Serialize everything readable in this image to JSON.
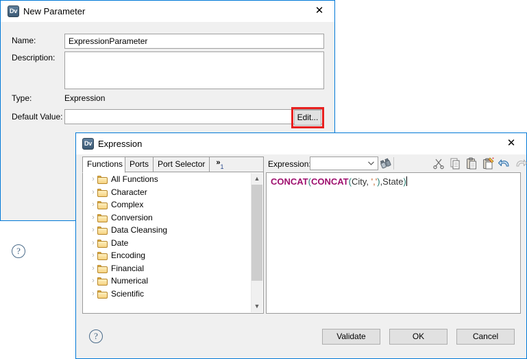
{
  "new_parameter_dialog": {
    "title": "New Parameter",
    "app_icon_label": "Dv",
    "close_label": "✕",
    "help_label": "?",
    "fields": {
      "name_label": "Name:",
      "name_value": "ExpressionParameter",
      "description_label": "Description:",
      "description_value": "",
      "type_label": "Type:",
      "type_value": "Expression",
      "default_value_label": "Default Value:",
      "default_value": "",
      "edit_button_label": "Edit..."
    }
  },
  "expression_dialog": {
    "title": "Expression",
    "app_icon_label": "Dv",
    "close_label": "✕",
    "help_label": "?",
    "tabs": [
      {
        "label": "Functions",
        "selected": true
      },
      {
        "label": "Ports",
        "selected": false
      },
      {
        "label": "Port Selector",
        "selected": false
      }
    ],
    "tab_overflow": {
      "chevrons": "»",
      "count": "1"
    },
    "tree": {
      "items": [
        {
          "label": "All Functions"
        },
        {
          "label": "Character"
        },
        {
          "label": "Complex"
        },
        {
          "label": "Conversion"
        },
        {
          "label": "Data Cleansing"
        },
        {
          "label": "Date"
        },
        {
          "label": "Encoding"
        },
        {
          "label": "Financial"
        },
        {
          "label": "Numerical"
        },
        {
          "label": "Scientific"
        }
      ],
      "expand_chevron": "›",
      "scroll_up": "▲",
      "scroll_down": "▼"
    },
    "expression_panel": {
      "label": "Expression:",
      "combo_value": "",
      "combo_arrow": "⌄",
      "toolbar": [
        {
          "name": "find-icon",
          "title": "Find"
        },
        {
          "name": "cut-icon",
          "title": "Cut"
        },
        {
          "name": "copy-icon",
          "title": "Copy"
        },
        {
          "name": "paste-icon",
          "title": "Paste"
        },
        {
          "name": "paste-special-icon",
          "title": "Paste Special"
        },
        {
          "name": "undo-icon",
          "title": "Undo"
        },
        {
          "name": "redo-icon",
          "title": "Redo"
        }
      ],
      "code_text": "CONCAT(CONCAT(City, ','),State)",
      "code_tokens": [
        {
          "t": "CONCAT",
          "k": "fn"
        },
        {
          "t": "(",
          "k": "paren"
        },
        {
          "t": "CONCAT",
          "k": "fn"
        },
        {
          "t": "(",
          "k": "paren"
        },
        {
          "t": "City,",
          "k": "id"
        },
        {
          "t": " ",
          "k": "id"
        },
        {
          "t": "','",
          "k": "str"
        },
        {
          "t": ")",
          "k": "paren"
        },
        {
          "t": ",State",
          "k": "id"
        },
        {
          "t": ")",
          "k": "paren"
        }
      ]
    },
    "buttons": {
      "validate": "Validate",
      "ok": "OK",
      "cancel": "Cancel"
    }
  },
  "colors": {
    "window_border": "#0078d7",
    "dialog_bg": "#f0f0f0",
    "highlight_red": "#e8201f",
    "function_keyword": "#9e0f6e",
    "paren": "#1f7a6e",
    "string_literal": "#c05a1f",
    "identifier": "#333333",
    "folder": "#e8b84b"
  }
}
